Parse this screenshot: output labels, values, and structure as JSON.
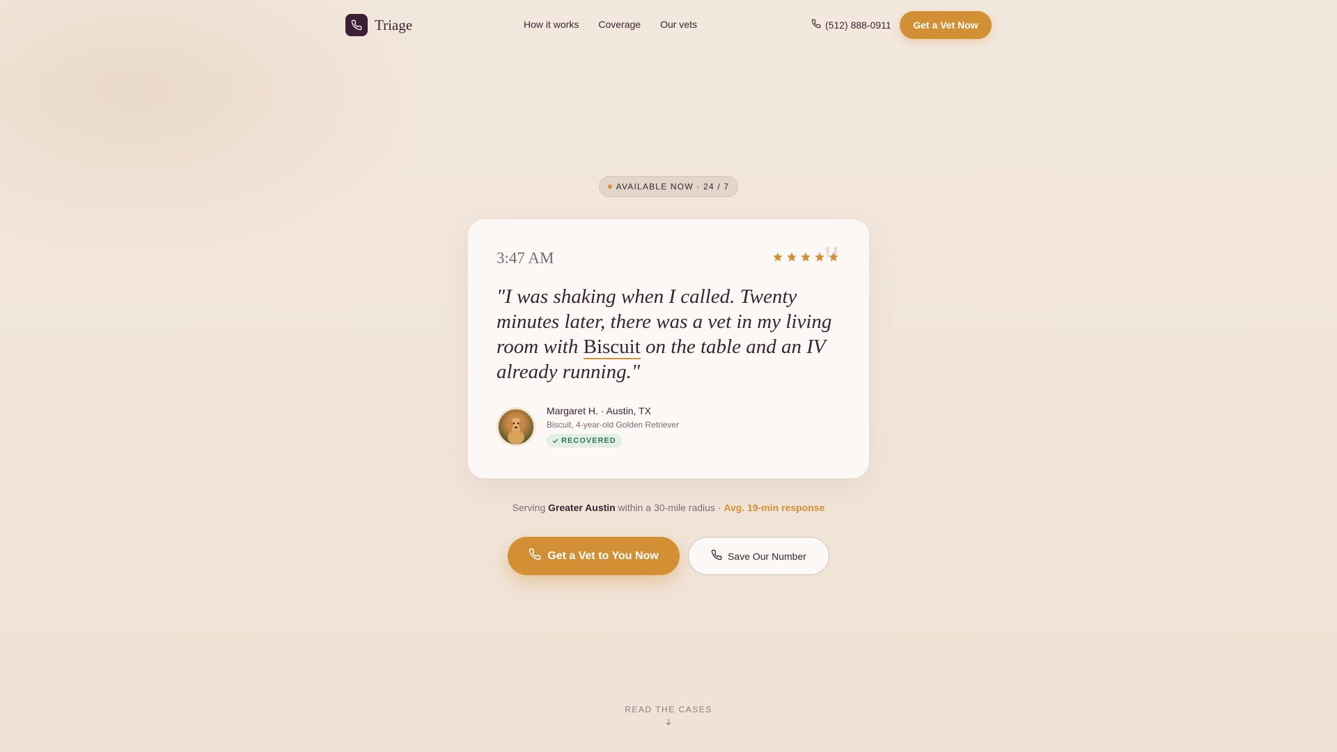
{
  "nav": {
    "brand": "Triage",
    "links": [
      "How it works",
      "Coverage",
      "Our vets"
    ],
    "phone": "(512) 888-0911",
    "cta": "Get a Vet Now"
  },
  "badge": "AVAILABLE NOW · 24 / 7",
  "testimonial": {
    "time": "3:47 AM",
    "rating": 5,
    "quote_before": "\"I was shaking when I called. Twenty minutes later, there was a vet in my living room with ",
    "pet_name": "Biscuit",
    "quote_after": " on the table and an IV already running.\"",
    "author": "Margaret H. · Austin, TX",
    "pet_desc": "Biscuit, 4-year-old Golden Retriever",
    "status": "RECOVERED"
  },
  "serving": {
    "prefix": "Serving ",
    "area": "Greater Austin",
    "middle": " within a 30-mile radius · ",
    "response": "Avg. 19-min response"
  },
  "cta_primary": "Get a Vet to You Now",
  "cta_secondary": "Save Our Number",
  "read_cases": "READ THE CASES",
  "colors": {
    "accent": "#d28f34",
    "brand": "#3b1f35",
    "success": "#2f7a51"
  }
}
